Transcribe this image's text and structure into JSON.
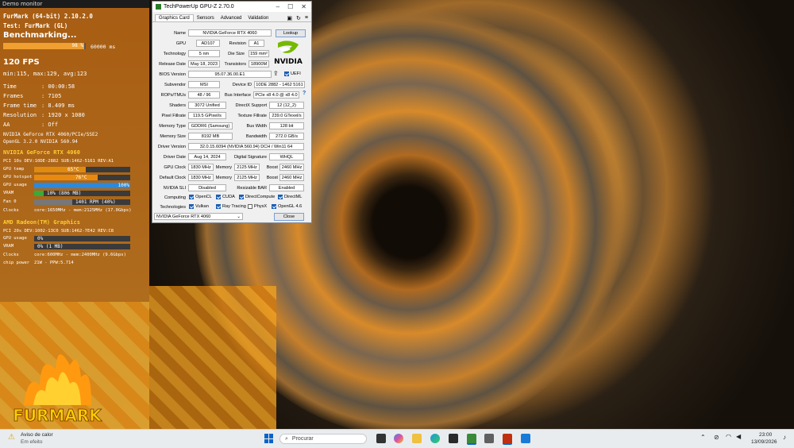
{
  "monitor": {
    "window_title": "Demo monitor",
    "app": "FurMark (64-bit) 2.10.2.0",
    "test": "Test: FurMark (GL)",
    "status": "Benchmarking...",
    "progress_percent": 98,
    "progress_label": "98 %",
    "duration": "60000 ms",
    "fps": "120 FPS",
    "fps_stats": "min:115, max:129, avg:123",
    "stats": [
      {
        "label": "Time",
        "value": ": 00:00:58"
      },
      {
        "label": "Frames",
        "value": ": 7105"
      },
      {
        "label": "Frame time",
        "value": ": 8.409 ms"
      },
      {
        "label": "Resolution",
        "value": ": 1920 x 1080"
      },
      {
        "label": "AA",
        "value": ": Off"
      }
    ],
    "renderer": "NVIDIA GeForce RTX 4060/PCIe/SSE2",
    "opengl": "OpenGL 3.2.0 NVIDIA 560.94",
    "gpu1": {
      "name": "NVIDIA GeForce RTX 4060",
      "pci": "PCI 10s      DEV:10DE-2882 SUB:1462-5161 REV:A1",
      "temp_label": "GPU temp",
      "temp_value": "65°C",
      "temp_fill": 0.54,
      "hotspot_label": "GPU hotspot",
      "hotspot_value": "76°C",
      "hotspot_fill": 0.66,
      "usage_label": "GPU usage",
      "usage_value": "100%",
      "usage_fill": 1.0,
      "vram_label": "VRAM",
      "vram_value": "10% (806 MB)",
      "vram_fill": 0.1,
      "fan_label": "Fan 0",
      "fan_value": "1401 RPM (40%)",
      "fan_fill": 0.4,
      "clocks_label": "Clocks",
      "clocks_value": "core:1650MHz - mem:2125MHz (17.0Gbps)"
    },
    "gpu2": {
      "name": "AMD Radeon(TM) Graphics",
      "pci": "PCI 20s      DEV:1002-13C0 SUB:1462-7E42 REV:C8",
      "usage_label": "GPU usage",
      "usage_value": "0%",
      "vram_label": "VRAM",
      "vram_value": "0% (1 MB)",
      "clocks_label": "Clocks",
      "clocks_value": "core:600MHz - mem:2400MHz (9.6Gbps)",
      "power_label": "chip power",
      "power_value": "21W - PPW:5.714"
    },
    "logo_text": "FURMARK"
  },
  "gpuz": {
    "title": "TechPowerUp GPU-Z 2.70.0",
    "tabs": [
      "Graphics Card",
      "Sensors",
      "Advanced",
      "Validation"
    ],
    "name": {
      "label": "Name",
      "value": "NVIDIA GeForce RTX 4060",
      "button": "Lookup"
    },
    "gpu": {
      "label": "GPU",
      "value": "AD107"
    },
    "revision": {
      "label": "Revision",
      "value": "A1"
    },
    "technology": {
      "label": "Technology",
      "value": "5 nm"
    },
    "die_size": {
      "label": "Die Size",
      "value": "159 mm²"
    },
    "release_date": {
      "label": "Release Date",
      "value": "May 18, 2023"
    },
    "transistors": {
      "label": "Transistors",
      "value": "18900M"
    },
    "bios": {
      "label": "BIOS Version",
      "value": "95.07.36.00.E1",
      "uefi": "UEFI"
    },
    "subvendor": {
      "label": "Subvendor",
      "value": "MSI"
    },
    "device_id": {
      "label": "Device ID",
      "value": "10DE 2882 - 1462 5161"
    },
    "rops": {
      "label": "ROPs/TMUs",
      "value": "48 / 96"
    },
    "bus_interface": {
      "label": "Bus Interface",
      "value": "PCIe x8 4.0 @ x8 4.0",
      "help": "?"
    },
    "shaders": {
      "label": "Shaders",
      "value": "3072 Unified"
    },
    "directx": {
      "label": "DirectX Support",
      "value": "12 (12_2)"
    },
    "pixel_fillrate": {
      "label": "Pixel Fillrate",
      "value": "119.5 GPixel/s"
    },
    "texture_fillrate": {
      "label": "Texture Fillrate",
      "value": "239.0 GTexel/s"
    },
    "memory_type": {
      "label": "Memory Type",
      "value": "GDDR6 (Samsung)"
    },
    "bus_width": {
      "label": "Bus Width",
      "value": "128 bit"
    },
    "memory_size": {
      "label": "Memory Size",
      "value": "8192 MB"
    },
    "bandwidth": {
      "label": "Bandwidth",
      "value": "272.0 GB/s"
    },
    "driver_version": {
      "label": "Driver Version",
      "value": "32.0.15.6094 (NVIDIA 560.94) DCH / Win11 64"
    },
    "driver_date": {
      "label": "Driver Date",
      "value": "Aug 14, 2024"
    },
    "digital_signature": {
      "label": "Digital Signature",
      "value": "WHQL"
    },
    "gpu_clock": {
      "label": "GPU Clock",
      "value": "1830 MHz",
      "mem_label": "Memory",
      "mem_value": "2125 MHz",
      "boost_label": "Boost",
      "boost_value": "2460 MHz"
    },
    "default_clock": {
      "label": "Default Clock",
      "value": "1830 MHz",
      "mem_label": "Memory",
      "mem_value": "2125 MHz",
      "boost_label": "Boost",
      "boost_value": "2460 MHz"
    },
    "sli": {
      "label": "NVIDIA SLI",
      "value": "Disabled",
      "rebar_label": "Resizable BAR",
      "rebar_value": "Enabled"
    },
    "computing": {
      "label": "Computing",
      "items": [
        "OpenCL",
        "CUDA",
        "DirectCompute",
        "DirectML"
      ]
    },
    "technologies": {
      "label": "Technologies",
      "items": [
        "Vulkan",
        "Ray Tracing",
        "PhysX",
        "OpenGL 4.6"
      ]
    },
    "selected_gpu": "NVIDIA GeForce RTX 4060",
    "close": "Close",
    "vendor_logo": "NVIDIA"
  },
  "taskbar": {
    "notification_title": "Aviso de calor",
    "notification_sub": "Em efeito",
    "search_placeholder": "Procurar",
    "time": "23:00",
    "date": "13/09/2026"
  }
}
